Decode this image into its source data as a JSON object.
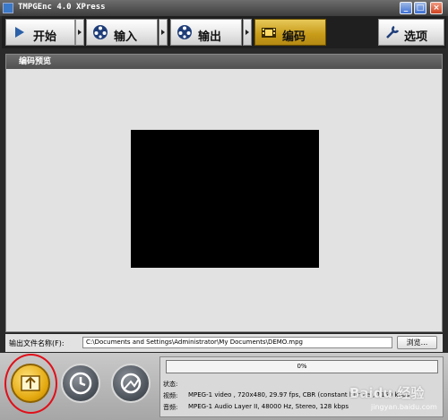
{
  "window": {
    "title": "TMPGEnc 4.0 XPress",
    "controls": [
      "_",
      "□",
      "×"
    ]
  },
  "toolbar": {
    "tabs": [
      {
        "label": "开始",
        "icon": "play-icon",
        "active": false
      },
      {
        "label": "输入",
        "icon": "film-reel-icon",
        "active": false
      },
      {
        "label": "输出",
        "icon": "film-reel-icon",
        "active": false
      },
      {
        "label": "编码",
        "icon": "film-strip-icon",
        "active": true
      }
    ],
    "options_label": "选项"
  },
  "preview_panel": {
    "header": "编码预览"
  },
  "output": {
    "label": "输出文件名称(F):",
    "path": "C:\\Documents and Settings\\Administrator\\My Documents\\DEMO.mpg",
    "browse_label": "浏览..."
  },
  "controls": {
    "buttons": [
      {
        "icon": "start-encode-icon"
      },
      {
        "icon": "clock-icon"
      },
      {
        "icon": "batch-encode-icon"
      }
    ]
  },
  "status": {
    "progress_text": "0%",
    "progress": 0,
    "state_label": "状态:",
    "video_label": "视频:",
    "video_value": "MPEG-1 video , 720x480, 29.97 fps, CBR (constant bitrate), 1150 kbps",
    "audio_label": "音频:",
    "audio_value": "MPEG-1 Audio Layer II, 48000 Hz, Stereo, 128 kbps"
  },
  "watermark": {
    "main": "Baidu 经验",
    "sub": "jingyan.baidu.com"
  },
  "colors": {
    "accent": "#d9a51b",
    "annotation": "#e0101a"
  }
}
